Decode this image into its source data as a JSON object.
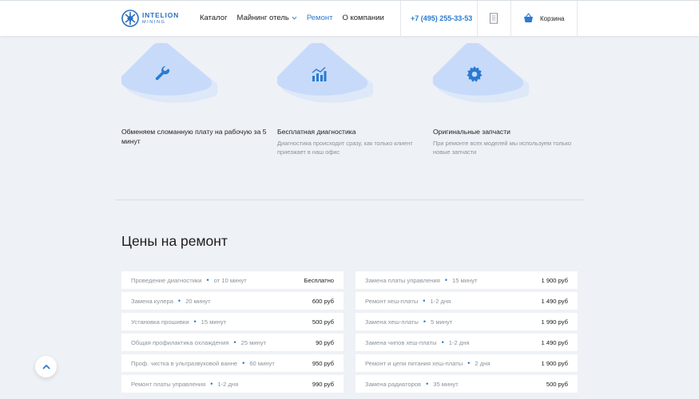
{
  "header": {
    "logo": {
      "name": "INTELION",
      "sub": "MINING"
    },
    "nav": [
      {
        "label": "Каталог",
        "dropdown": false,
        "active": false
      },
      {
        "label": "Майнинг отель",
        "dropdown": true,
        "active": false
      },
      {
        "label": "Ремонт",
        "dropdown": false,
        "active": true
      },
      {
        "label": "О компании",
        "dropdown": false,
        "active": false
      }
    ],
    "phone": "+7 (495) 255-33-53",
    "cart_label": "Корзина"
  },
  "colors": {
    "accent": "#2a7bd1",
    "tile": "#cfe0fb",
    "background": "#eef1f5"
  },
  "features": [
    {
      "icon": "wrench-icon",
      "title": "Обменяем сломанную плату на рабочую за 5 минут",
      "desc": ""
    },
    {
      "icon": "chart-icon",
      "title": "Бесплатная диагностика",
      "desc": "Диагностика происходит сразу, как только клиент приезжает в наш офис"
    },
    {
      "icon": "gear-icon",
      "title": "Оригинальные запчасти",
      "desc": "При ремонте всех моделей мы используем только новые запчасти"
    }
  ],
  "prices": {
    "title": "Цены на ремонт",
    "left": [
      {
        "name": "Проведение диагностики",
        "time": "от 10 минут",
        "price": "Бесплатно"
      },
      {
        "name": "Замена кулера",
        "time": "20 минут",
        "price": "600 руб"
      },
      {
        "name": "Установка прошивки",
        "time": "15 минут",
        "price": "500 руб"
      },
      {
        "name": "Общая профилактика охлаждения",
        "time": "25 минут",
        "price": "90 руб"
      },
      {
        "name": "Проф. чистка в ультразвуковой ванне",
        "time": "60 минут",
        "price": "950 руб"
      },
      {
        "name": "Ремонт платы управления",
        "time": "1-2 дня",
        "price": "990 руб"
      }
    ],
    "right": [
      {
        "name": "Замена платы управления",
        "time": "15 минут",
        "price": "1 900 руб"
      },
      {
        "name": "Ремонт хеш-платы",
        "time": "1-2 дня",
        "price": "1 490 руб"
      },
      {
        "name": "Замена хеш-платы",
        "time": "5 минут",
        "price": "1 990 руб"
      },
      {
        "name": "Замена чипов хеш-платы",
        "time": "1-2 дня",
        "price": "1 490 руб"
      },
      {
        "name": "Ремонт и цепи питания хеш-платы",
        "time": "2 дня",
        "price": "1 900 руб"
      },
      {
        "name": "Замена радиаторов",
        "time": "35 минут",
        "price": "500 руб"
      }
    ]
  }
}
